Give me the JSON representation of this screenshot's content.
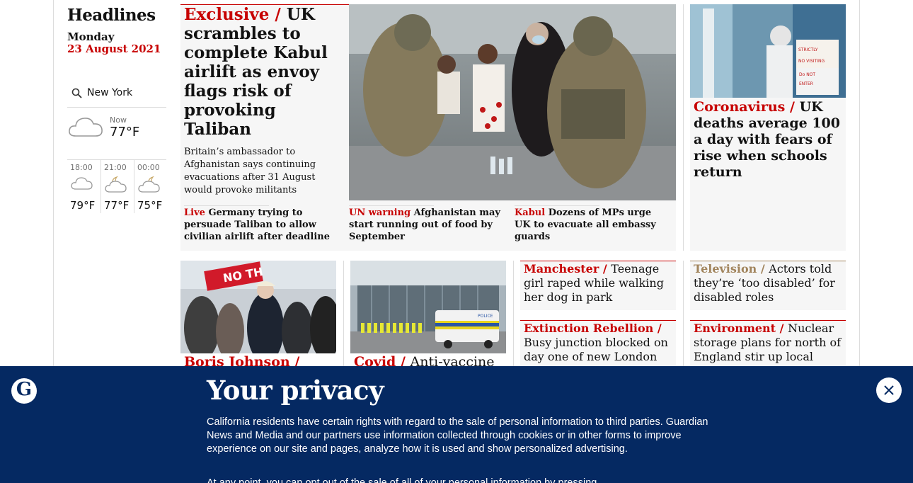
{
  "headlines": {
    "title": "Headlines",
    "day": "Monday",
    "date": "23 August 2021"
  },
  "weather": {
    "location": "New York",
    "now_label": "Now",
    "now_temp": "77°F",
    "now_icon": "cloud-icon",
    "forecast": [
      {
        "time": "18:00",
        "temp": "79°F",
        "icon": "cloud-icon"
      },
      {
        "time": "21:00",
        "temp": "77°F",
        "icon": "moon-cloud-icon"
      },
      {
        "time": "00:00",
        "temp": "75°F",
        "icon": "moon-cloud-icon"
      }
    ]
  },
  "main_story": {
    "kicker": "Exclusive /",
    "headline": "UK scrambles to complete Kabul airlift as envoy flags risk of provoking Taliban",
    "standfirst": "Britain’s ambassador to Afghanistan says continuing evacuations after 31 August would provoke militants",
    "sublinks": [
      {
        "kicker": "Live",
        "text": "Germany trying to persuade Taliban to allow civilian airlift after deadline"
      },
      {
        "kicker": "UN warning",
        "text": "Afghanistan may start running out of food by September"
      },
      {
        "kicker": "Kabul",
        "text": "Dozens of MPs urge UK to evacuate all embassy guards"
      }
    ]
  },
  "side_story": {
    "kicker": "Coronavirus /",
    "headline": "UK deaths average 100 a day with fears of rise when schools return",
    "sign_lines": [
      "STRICTLY",
      "NO VISITING",
      "Do NOT",
      "ENTER"
    ]
  },
  "row2": {
    "johnson": {
      "kicker": "Boris Johnson /",
      "sign_text": "NO TH"
    },
    "covid": {
      "kicker": "Covid /",
      "headline": "Anti-vaccine",
      "van_label": "POLICE"
    },
    "manchester": {
      "kicker": "Manchester /",
      "headline": "Teenage girl raped while walking her dog in park"
    },
    "extinction": {
      "kicker": "Extinction Rebellion /",
      "headline": "Busy junction blocked on day one of new London protests"
    },
    "television": {
      "kicker": "Television /",
      "headline": "Actors told they’re ‘too disabled’ for disabled roles"
    },
    "environment": {
      "kicker": "Environment /",
      "headline": "Nuclear storage plans for north of England stir up local opposition"
    }
  },
  "privacy": {
    "logo_letter": "G",
    "title": "Your privacy",
    "text": "California residents have certain rights with regard to the sale of personal information to third parties. Guardian News and Media and our partners use information collected through cookies or in other forms to improve experience on our site and pages, analyze how it is used and show personalized advertising.",
    "text2": "At any point, you can opt out of the sale of all of your personal information by pressing",
    "close_icon": "close-icon"
  },
  "colors": {
    "news_red": "#c70000",
    "culture_gold": "#a1845c",
    "banner_navy": "#052962"
  }
}
